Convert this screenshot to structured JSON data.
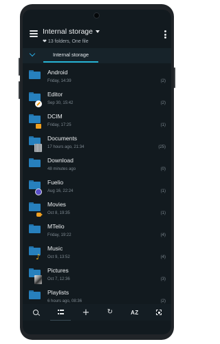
{
  "header": {
    "title": "Internal storage",
    "subtitle": "13 folders, One file"
  },
  "pathbar": {
    "current": "Internal storage"
  },
  "folders": [
    {
      "name": "Android",
      "meta": "Friday, 14:39",
      "count": "(2)",
      "badge": ""
    },
    {
      "name": "Editor",
      "meta": "Sep 30, 15:42",
      "count": "(2)",
      "badge": "editor"
    },
    {
      "name": "DCIM",
      "meta": "Friday, 17:25",
      "count": "(1)",
      "badge": "dcim"
    },
    {
      "name": "Documents",
      "meta": "17 hours ago, 21:34",
      "count": "(25)",
      "badge": "docs"
    },
    {
      "name": "Download",
      "meta": "48 minutes ago",
      "count": "(0)",
      "badge": ""
    },
    {
      "name": "Fuelio",
      "meta": "Aug 16, 22:24",
      "count": "(1)",
      "badge": "fuelio"
    },
    {
      "name": "Movies",
      "meta": "Oct 8, 19:35",
      "count": "(1)",
      "badge": "movies"
    },
    {
      "name": "MTelio",
      "meta": "Friday, 19:22",
      "count": "(4)",
      "badge": ""
    },
    {
      "name": "Music",
      "meta": "Oct 9, 13:52",
      "count": "(4)",
      "badge": "music"
    },
    {
      "name": "Pictures",
      "meta": "Oct 7, 12:36",
      "count": "(3)",
      "badge": "pictures"
    },
    {
      "name": "Playlists",
      "meta": "6 hours ago, 08:36",
      "count": "(2)",
      "badge": ""
    }
  ],
  "toolbar": {
    "sort_label": "AZ",
    "icons": [
      "search-icon",
      "view-list-icon",
      "add-icon",
      "refresh-icon",
      "sort-az-icon",
      "select-icon"
    ]
  },
  "colors": {
    "background": "#121a1f",
    "folder": "#2780bd",
    "accent": "#26b3d4"
  }
}
